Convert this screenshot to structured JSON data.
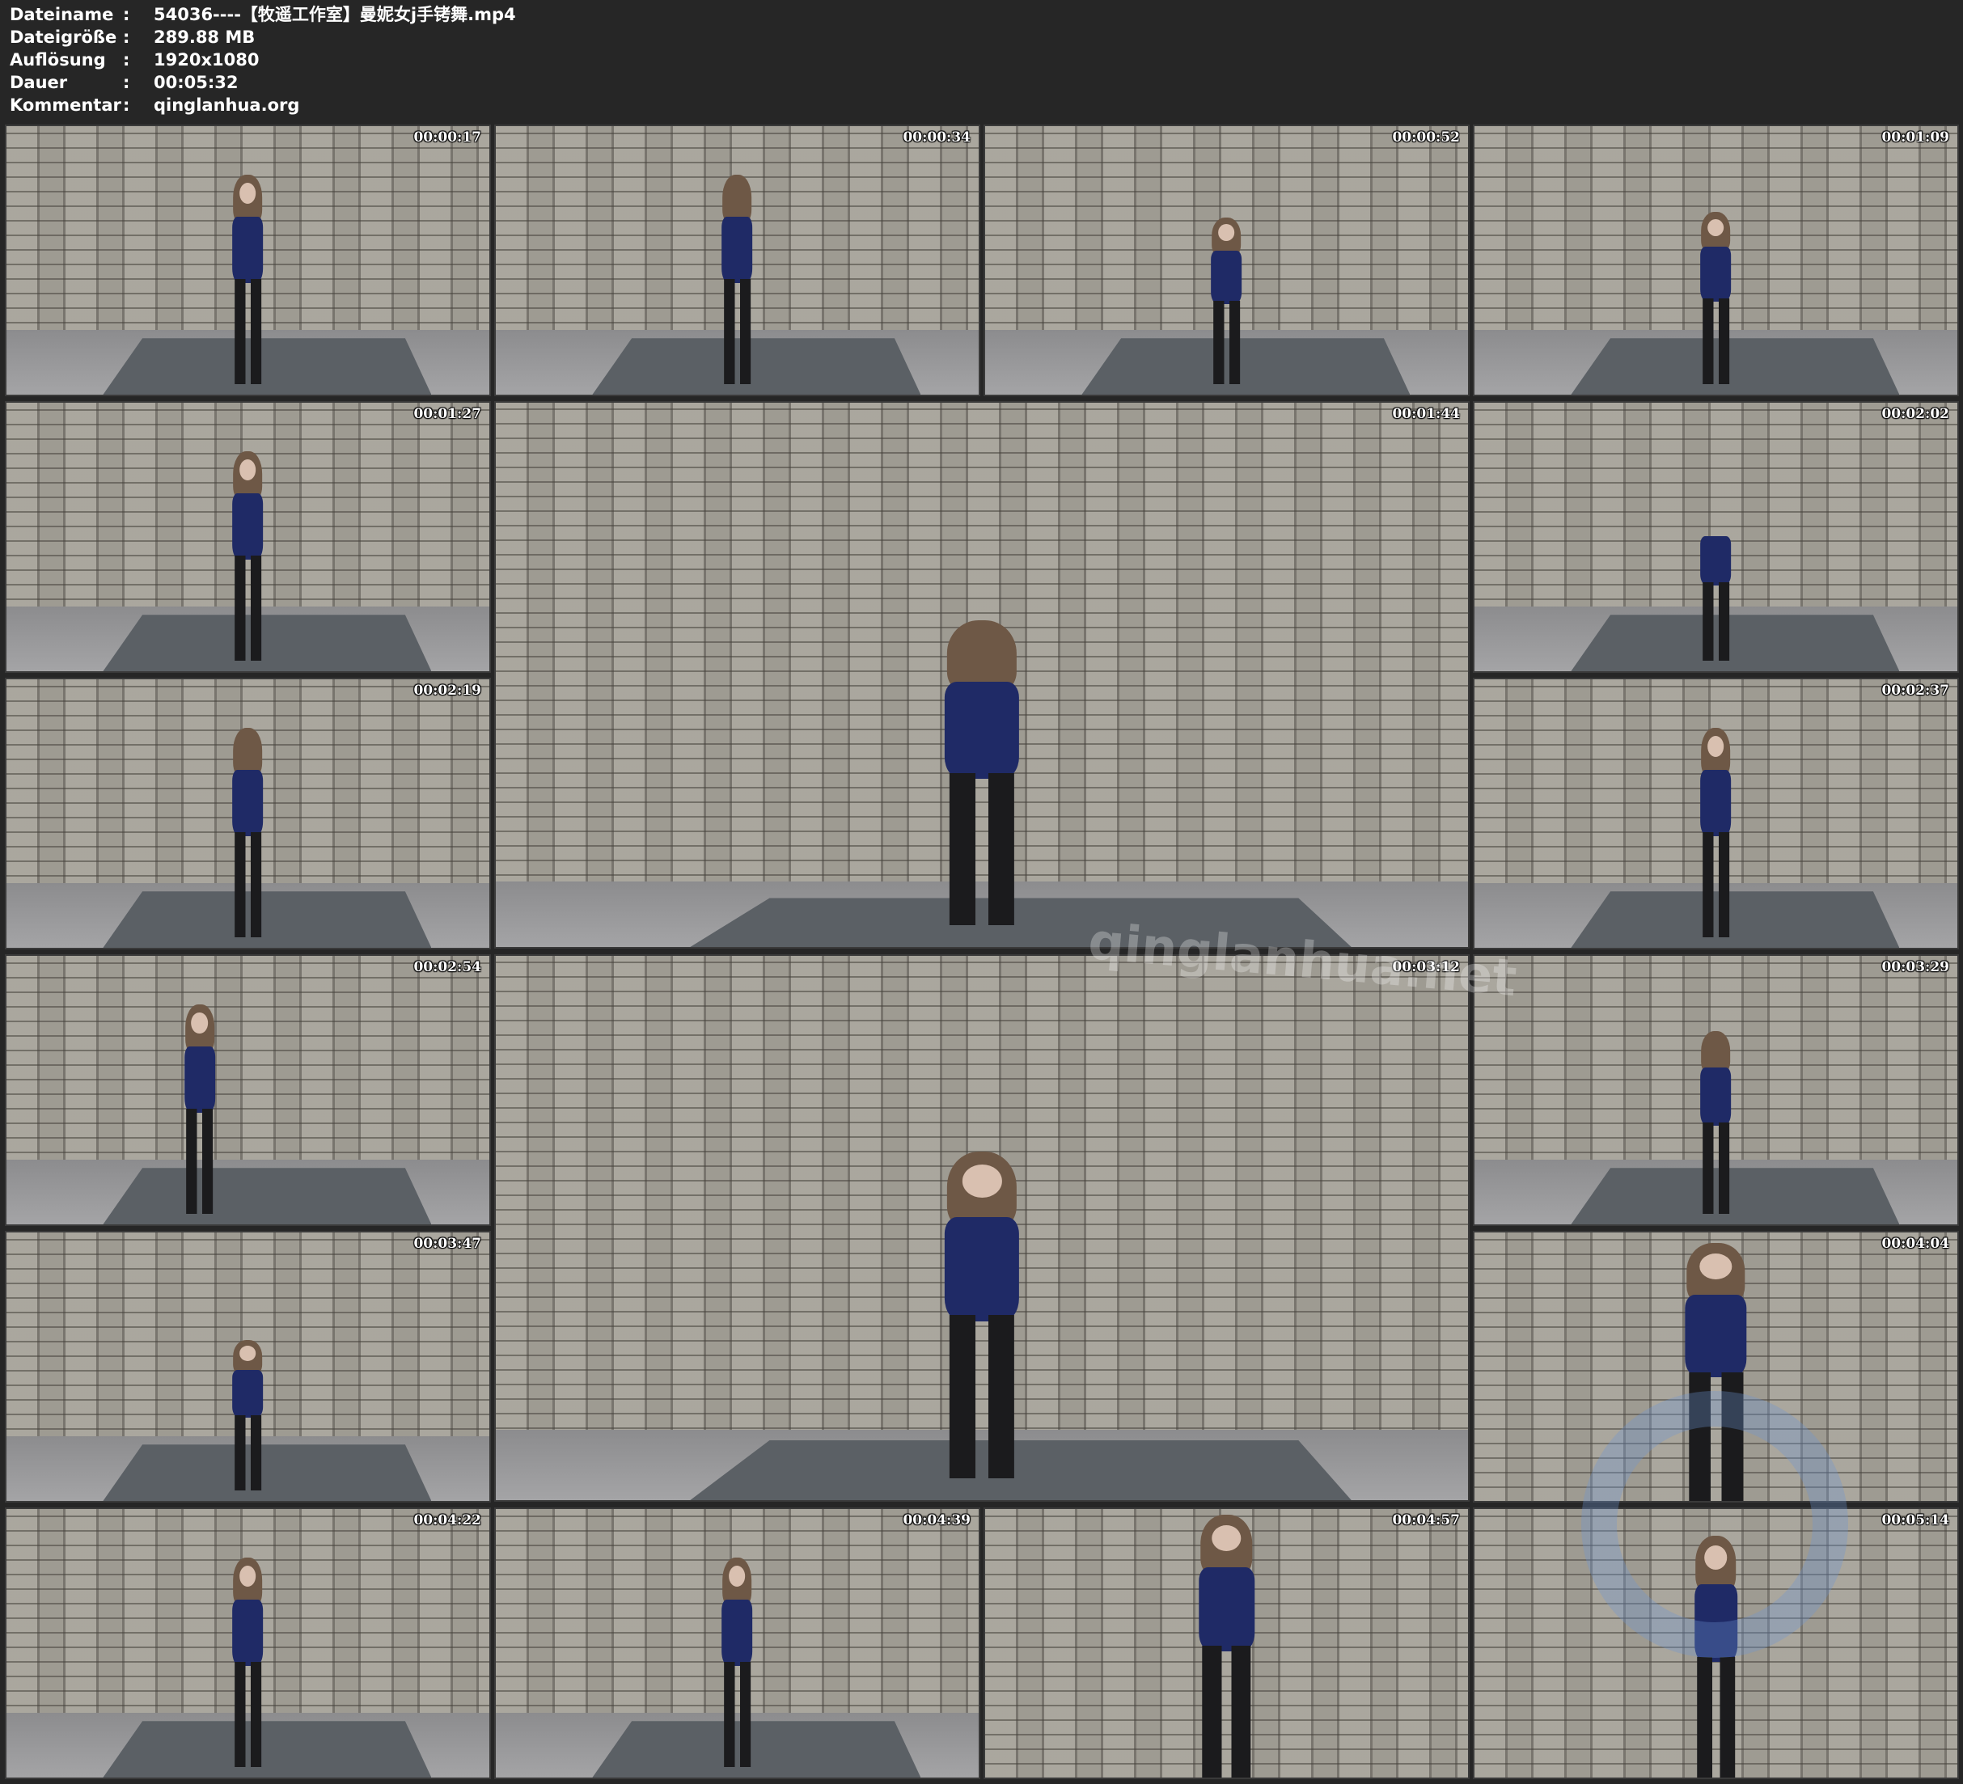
{
  "header": {
    "rows": [
      {
        "key": "Dateiname",
        "sep": ":",
        "value": "54036----【牧遥工作室】曼妮女j手铐舞.mp4"
      },
      {
        "key": "Dateigröße",
        "sep": ":",
        "value": "289.88 MB"
      },
      {
        "key": "Auflösung",
        "sep": ":",
        "value": "1920x1080"
      },
      {
        "key": "Dauer",
        "sep": ":",
        "value": "00:05:32"
      },
      {
        "key": "Kommentar",
        "sep": ":",
        "value": "qinglanhua.org"
      }
    ]
  },
  "thumbnails": [
    {
      "timestamp": "00:00:17"
    },
    {
      "timestamp": "00:00:34"
    },
    {
      "timestamp": "00:00:52"
    },
    {
      "timestamp": "00:01:09"
    },
    {
      "timestamp": "00:01:27"
    },
    {
      "timestamp": "00:01:44"
    },
    {
      "timestamp": "00:02:02"
    },
    {
      "timestamp": "00:02:19"
    },
    {
      "timestamp": "00:02:37"
    },
    {
      "timestamp": "00:02:54"
    },
    {
      "timestamp": "00:03:12"
    },
    {
      "timestamp": "00:03:29"
    },
    {
      "timestamp": "00:03:47"
    },
    {
      "timestamp": "00:04:04"
    },
    {
      "timestamp": "00:04:22"
    },
    {
      "timestamp": "00:04:39"
    },
    {
      "timestamp": "00:04:57"
    },
    {
      "timestamp": "00:05:14"
    }
  ],
  "watermark": {
    "text": "qinglanhua.net"
  }
}
